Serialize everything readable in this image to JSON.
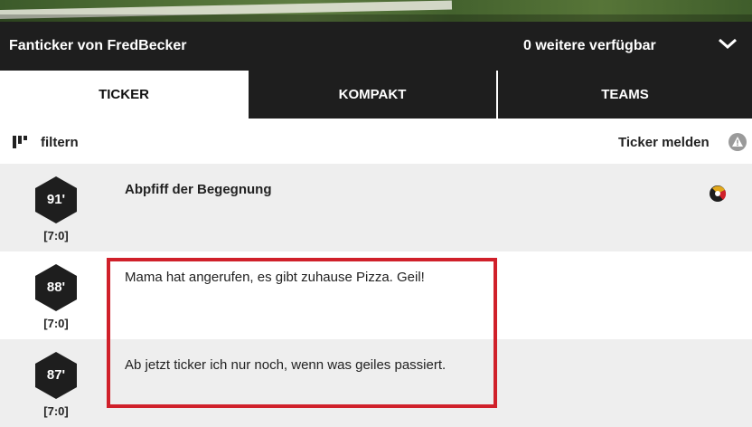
{
  "header": {
    "title": "Fanticker von FredBecker",
    "more_available": "0 weitere verfügbar",
    "toggle_icon": "chevron-down-icon"
  },
  "tabs": [
    {
      "label": "TICKER",
      "active": true
    },
    {
      "label": "KOMPAKT",
      "active": false
    },
    {
      "label": "TEAMS",
      "active": false
    }
  ],
  "toolbar": {
    "filter_label": "filtern",
    "filter_icon": "filter-icon",
    "report_label": "Ticker melden",
    "report_icon": "warning-icon"
  },
  "entries": [
    {
      "minute": "91'",
      "score": "[7:0]",
      "text": "Abpfiff der Begegnung",
      "bold": true,
      "icon": "final-whistle-icon"
    },
    {
      "minute": "88'",
      "score": "[7:0]",
      "text": "Mama hat angerufen, es gibt zuhause Pizza. Geil!",
      "bold": false
    },
    {
      "minute": "87'",
      "score": "[7:0]",
      "text": "Ab jetzt ticker ich nur noch, wenn was geiles passiert.",
      "bold": false
    }
  ],
  "colors": {
    "dark_bar": "#1e1e1e",
    "hexagon": "#1e1e1e",
    "highlight_border": "#d0202a",
    "row_grey": "#eeeeee"
  }
}
